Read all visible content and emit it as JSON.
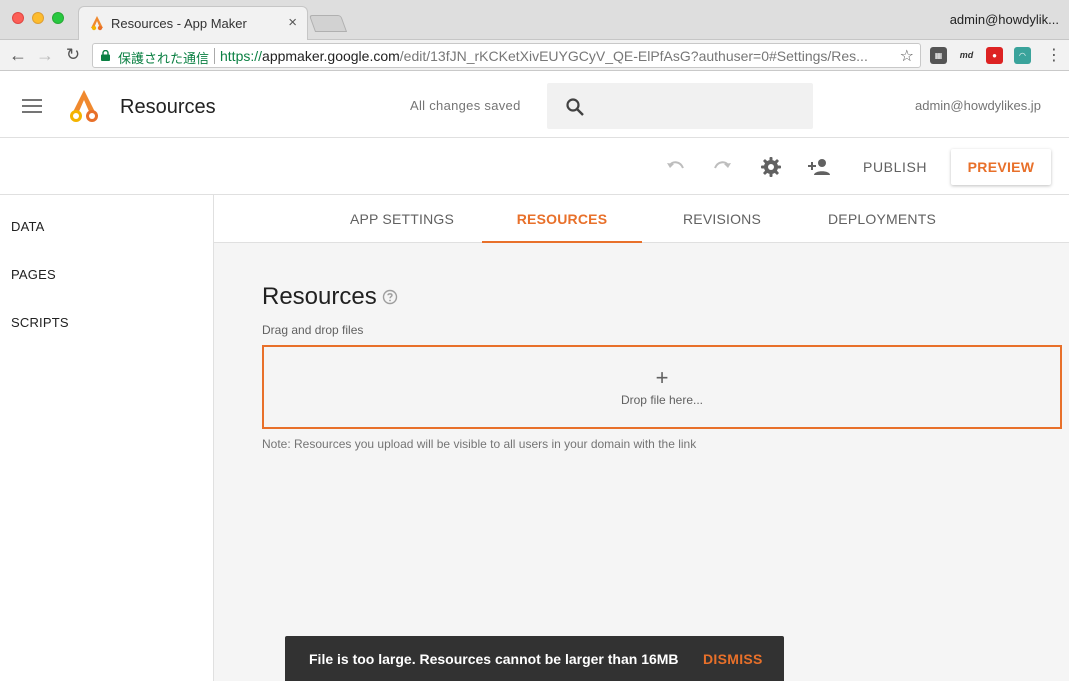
{
  "browser": {
    "tab_title": "Resources - App Maker",
    "tab_close": "×",
    "profile": "admin@howdylik...",
    "secure_label": "保護された通信",
    "url_scheme": "https://",
    "url_host": "appmaker.google.com",
    "url_path": "/edit/13fJN_rKCKetXivEUYGCyV_QE-ElPfAsG?authuser=0#Settings/Res...",
    "extensions": [
      "filmstrip-icon",
      "md",
      "chili-icon",
      "gauge-icon"
    ],
    "ext_md_label": "md"
  },
  "header": {
    "title": "Resources",
    "save_status": "All changes saved",
    "user_email": "admin@howdylikes.jp"
  },
  "actions": {
    "publish_label": "PUBLISH",
    "preview_label": "PREVIEW"
  },
  "sidebar": {
    "items": [
      {
        "label": "DATA"
      },
      {
        "label": "PAGES"
      },
      {
        "label": "SCRIPTS"
      }
    ]
  },
  "tabs": [
    {
      "label": "APP SETTINGS"
    },
    {
      "label": "RESOURCES",
      "active": true
    },
    {
      "label": "REVISIONS"
    },
    {
      "label": "DEPLOYMENTS"
    }
  ],
  "resources": {
    "title": "Resources",
    "drag_hint": "Drag and drop files",
    "plus": "+",
    "drop_text": "Drop file here...",
    "note": "Note: Resources you upload will be visible to all users in your domain with the link"
  },
  "snackbar": {
    "message": "File is too large. Resources cannot be larger than 16MB",
    "action": "DISMISS"
  },
  "colors": {
    "accent": "#e8702a",
    "secure_green": "#0b8043",
    "snackbar_bg": "#323232"
  }
}
